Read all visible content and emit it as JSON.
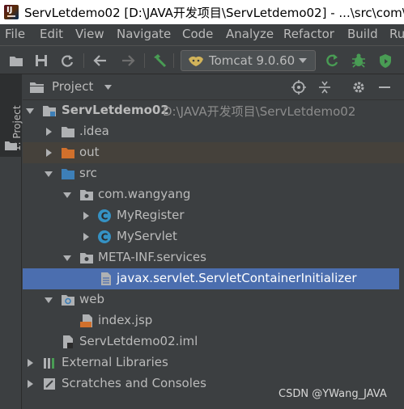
{
  "window": {
    "title": "ServLetdemo02 [D:\\JAVA开发项目\\ServLetdemo02] - ...\\src\\com\\w",
    "logo_text": "IJ"
  },
  "menu": [
    "File",
    "Edit",
    "View",
    "Navigate",
    "Code",
    "Analyze",
    "Refactor",
    "Build",
    "Ru"
  ],
  "toolbar": {
    "run_config": "Tomcat 9.0.60",
    "icons": [
      "open-icon",
      "save-icon",
      "sync-icon",
      "back-icon",
      "forward-icon",
      "build-icon",
      "run-icon",
      "debug-icon",
      "coverage-icon"
    ]
  },
  "sidebar": {
    "tab_label": "1: Project"
  },
  "panel": {
    "title": "Project"
  },
  "tree": [
    {
      "label": "ServLetdemo02",
      "path": "D:\\JAVA开发项目\\ServLetdemo02",
      "icon": "module-folder-icon"
    },
    {
      "label": ".idea",
      "icon": "folder-icon"
    },
    {
      "label": "out",
      "icon": "excluded-folder-icon"
    },
    {
      "label": "src",
      "icon": "source-folder-icon"
    },
    {
      "label": "com.wangyang",
      "icon": "package-icon"
    },
    {
      "label": "MyRegister",
      "icon": "class-icon"
    },
    {
      "label": "MyServlet",
      "icon": "class-icon"
    },
    {
      "label": "META-INF.services",
      "icon": "package-icon"
    },
    {
      "label": "javax.servlet.ServletContainerInitializer",
      "icon": "text-file-icon"
    },
    {
      "label": "web",
      "icon": "web-folder-icon"
    },
    {
      "label": "index.jsp",
      "icon": "jsp-file-icon"
    },
    {
      "label": "ServLetdemo02.iml",
      "icon": "iml-file-icon"
    },
    {
      "label": "External Libraries",
      "icon": "library-icon"
    },
    {
      "label": "Scratches and Consoles",
      "icon": "scratches-icon"
    }
  ],
  "watermark": "CSDN @YWang_JAVA",
  "colors": {
    "background": "#3c3f41",
    "selection": "#4b6eaf",
    "excluded_row": "#45413b",
    "folder_blue": "#3d7fb8",
    "excluded_orange": "#d1702c",
    "class_blue": "#3592c4",
    "run_green": "#499c54"
  }
}
